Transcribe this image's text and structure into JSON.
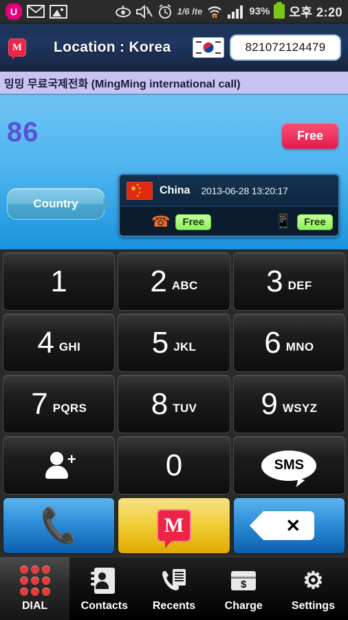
{
  "statusbar": {
    "carrier_icon": "uplus-logo-icon",
    "icons": [
      "envelope-icon",
      "photo-icon",
      "eye-icon",
      "mute-icon",
      "alarm-icon"
    ],
    "lte_label": "1/6 lte",
    "battery_percent": "93%",
    "time": "오후 2:20"
  },
  "header": {
    "app_logo": "mingming-logo-icon",
    "location_label": "Location : Korea",
    "flag": "korea-flag-icon",
    "phone_number": "821072124479"
  },
  "banner": {
    "text": "밍밍 무료국제전화 (MingMing international call)"
  },
  "blue_panel": {
    "country_prefix": "86",
    "free_button": "Free",
    "country_bubble": "Country",
    "info_card": {
      "flag": "china-flag-icon",
      "country": "China",
      "local_time": "2013-06-28 13:20:17",
      "rates": [
        {
          "icon": "landline-phone-icon",
          "label": "Free"
        },
        {
          "icon": "mobile-phone-icon",
          "label": "Free"
        }
      ]
    }
  },
  "keypad": {
    "keys": [
      {
        "digit": "1",
        "letters": ""
      },
      {
        "digit": "2",
        "letters": "ABC"
      },
      {
        "digit": "3",
        "letters": "DEF"
      },
      {
        "digit": "4",
        "letters": "GHI"
      },
      {
        "digit": "5",
        "letters": "JKL"
      },
      {
        "digit": "6",
        "letters": "MNO"
      },
      {
        "digit": "7",
        "letters": "PQRS"
      },
      {
        "digit": "8",
        "letters": "TUV"
      },
      {
        "digit": "9",
        "letters": "WSYZ"
      },
      {
        "digit": "0",
        "letters": ""
      }
    ],
    "add_contact_icon": "add-person-icon",
    "sms_label": "SMS"
  },
  "actions": {
    "call_icon": "call-handset-icon",
    "mingming_icon": "mingming-call-icon",
    "mingming_letter": "M",
    "backspace_icon": "backspace-icon",
    "backspace_glyph": "✕"
  },
  "nav": {
    "items": [
      {
        "label": "DIAL",
        "icon": "keypad-dots-icon",
        "active": true
      },
      {
        "label": "Contacts",
        "icon": "contacts-icon",
        "active": false
      },
      {
        "label": "Recents",
        "icon": "recents-icon",
        "active": false
      },
      {
        "label": "Charge",
        "icon": "charge-card-icon",
        "active": false
      },
      {
        "label": "Settings",
        "icon": "gear-icon",
        "active": false
      }
    ]
  },
  "colors": {
    "accent_pink": "#ee2345",
    "free_green": "#8cf25b",
    "panel_blue": "#4fb5ef",
    "banner_purple": "#c8c4f2",
    "action_blue": "#2e8ed8",
    "action_yellow": "#f2cf3c"
  }
}
